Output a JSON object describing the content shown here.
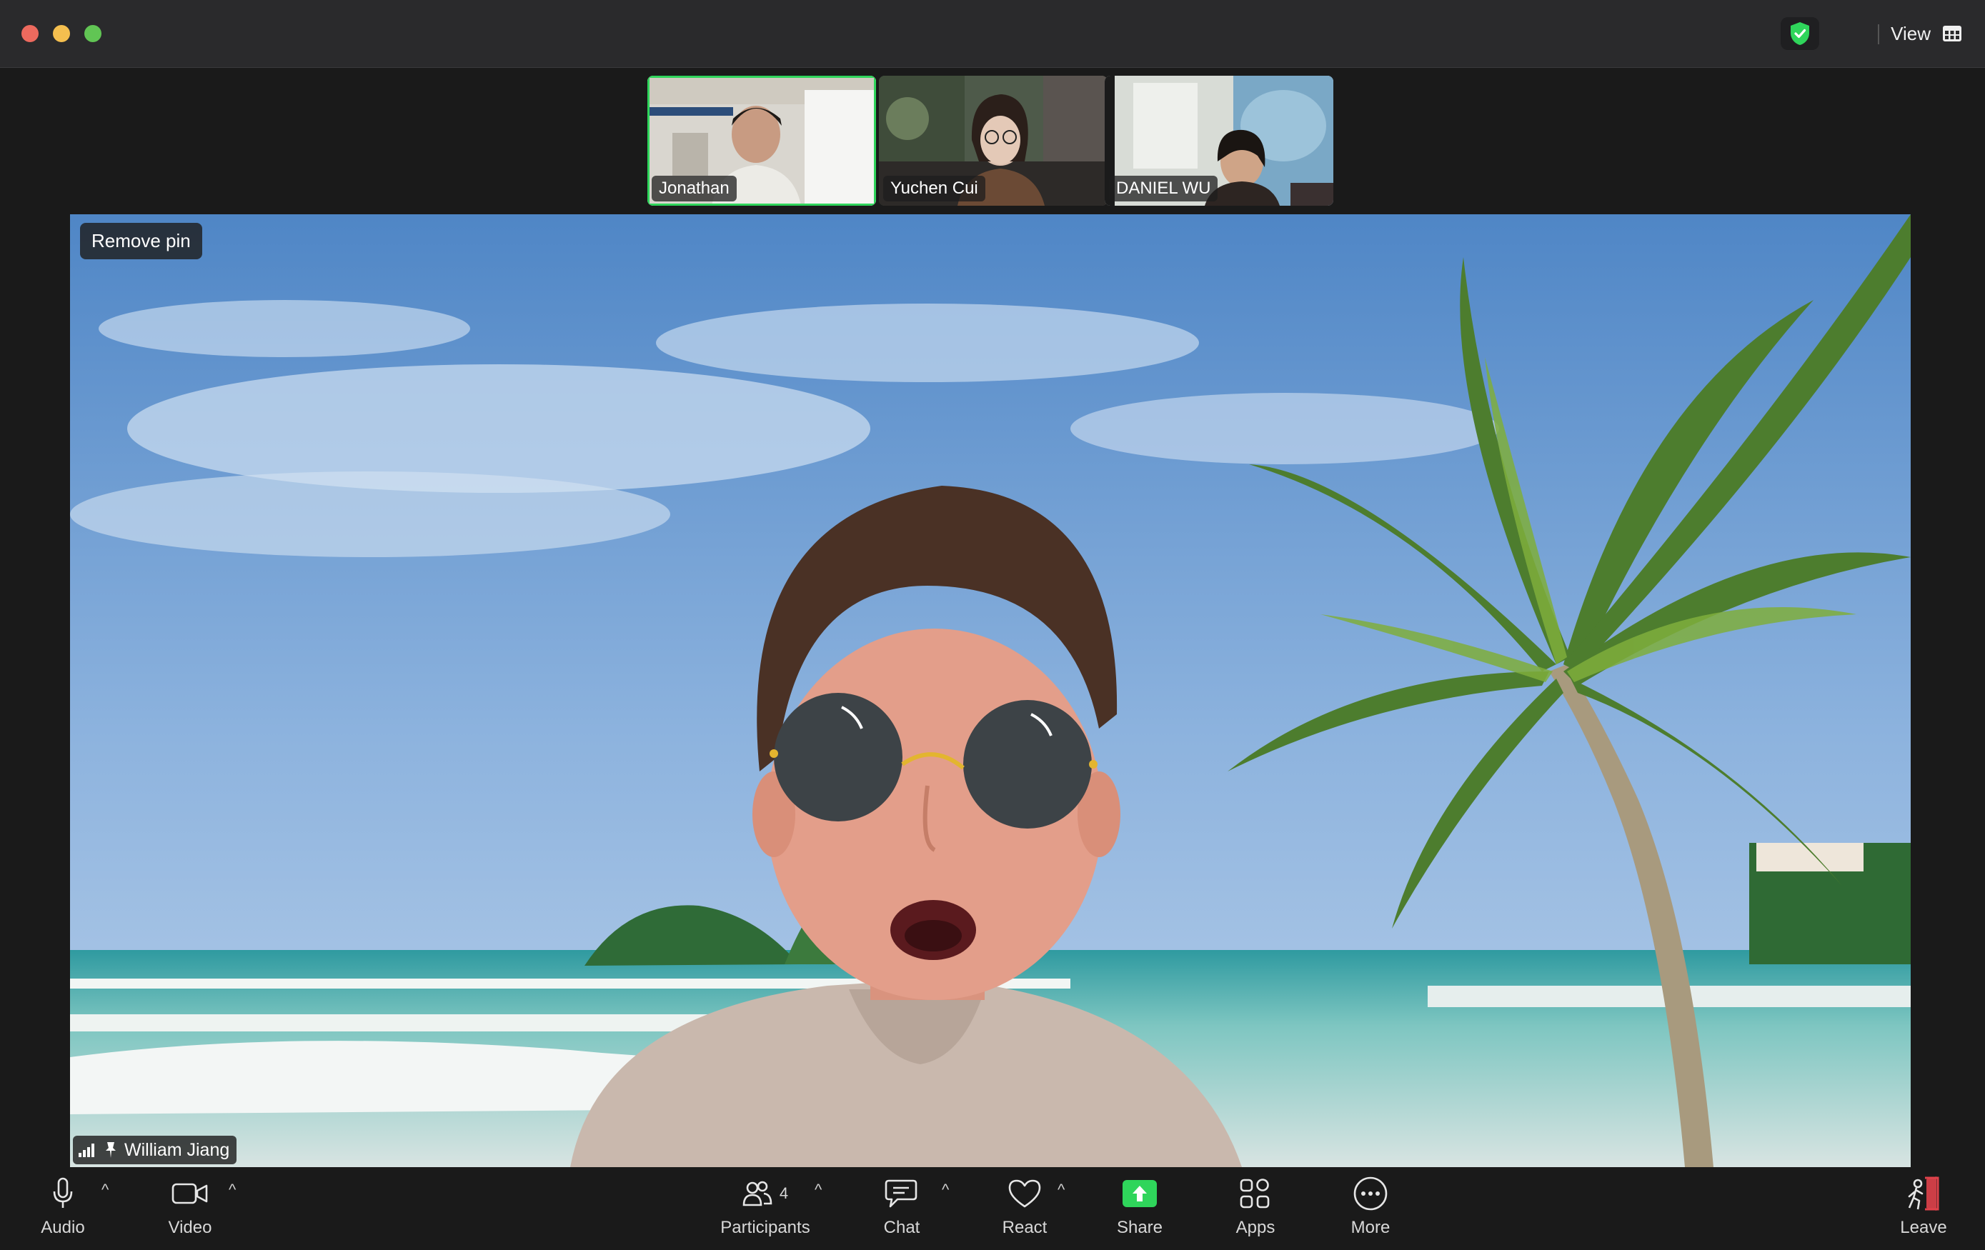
{
  "titlebar": {
    "view_label": "View"
  },
  "gallery": {
    "thumbnails": [
      {
        "name": "Jonathan",
        "active": true
      },
      {
        "name": "Yuchen Cui",
        "active": false
      },
      {
        "name": "DANIEL WU",
        "active": false
      }
    ]
  },
  "main_video": {
    "remove_pin_label": "Remove pin",
    "participant_name": "William Jiang"
  },
  "toolbar": {
    "audio_label": "Audio",
    "video_label": "Video",
    "participants_label": "Participants",
    "participants_count": "4",
    "chat_label": "Chat",
    "react_label": "React",
    "share_label": "Share",
    "apps_label": "Apps",
    "more_label": "More",
    "leave_label": "Leave"
  },
  "colors": {
    "active_border": "#2fd55b",
    "share_green": "#2fd55b",
    "leave_red": "#e0424b",
    "security_green": "#2fd55b"
  }
}
